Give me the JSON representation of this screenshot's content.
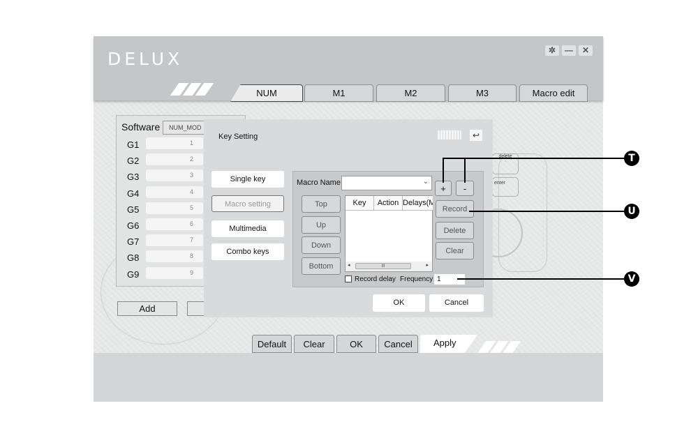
{
  "app": {
    "logo": "DELUX",
    "window_controls": {
      "settings": "✲",
      "minimize": "—",
      "close": "✕"
    }
  },
  "tabs": [
    {
      "label": "NUM",
      "active": true
    },
    {
      "label": "M1",
      "active": false
    },
    {
      "label": "M2",
      "active": false
    },
    {
      "label": "M3",
      "active": false
    },
    {
      "label": "Macro edit",
      "active": false
    }
  ],
  "left_panel": {
    "software_label": "Software",
    "software_value": "NUM_MOD",
    "keys": [
      {
        "label": "G1",
        "value": "1"
      },
      {
        "label": "G2",
        "value": "2"
      },
      {
        "label": "G3",
        "value": "3"
      },
      {
        "label": "G4",
        "value": "4"
      },
      {
        "label": "G5",
        "value": "5"
      },
      {
        "label": "G6",
        "value": "6"
      },
      {
        "label": "G7",
        "value": "7"
      },
      {
        "label": "G8",
        "value": "8"
      },
      {
        "label": "G9",
        "value": "9"
      }
    ],
    "add_label": "Add"
  },
  "background_keys": {
    "delete": "delete",
    "enter": "enter"
  },
  "dialog": {
    "title": "Key Setting",
    "side_buttons": [
      {
        "label": "Single key",
        "selected": false
      },
      {
        "label": "Macro setting",
        "selected": true
      },
      {
        "label": "Multimedia",
        "selected": false
      },
      {
        "label": "Combo keys",
        "selected": false
      }
    ],
    "macro": {
      "name_label": "Macro Name",
      "name_value": "",
      "plus_label": "+",
      "minus_label": "-",
      "move_buttons": [
        "Top",
        "Up",
        "Down",
        "Bottom"
      ],
      "columns": [
        "Key",
        "Action",
        "Delays(M"
      ],
      "scroll_thumb": "III",
      "action_buttons": [
        "Record",
        "Delete",
        "Clear"
      ],
      "record_delay_label": "Record delay",
      "record_delay_checked": false,
      "frequency_label": "Frequency",
      "frequency_value": "1"
    },
    "ok_label": "OK",
    "cancel_label": "Cancel"
  },
  "bottom_buttons": [
    "Default",
    "Clear",
    "OK",
    "Cancel",
    "Apply"
  ],
  "callouts": [
    "T",
    "U",
    "V"
  ]
}
